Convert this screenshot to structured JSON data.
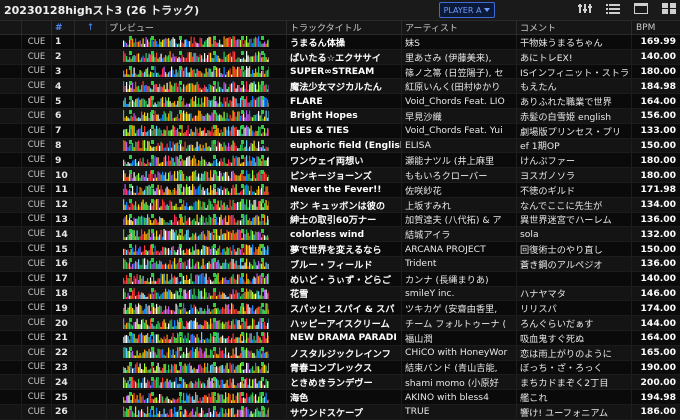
{
  "header": {
    "title": "20230128highスト3 (26 トラック)",
    "player_label": "PLAYER A"
  },
  "icons": [
    "settings-icon",
    "list-view-icon",
    "layout-icon",
    "grid-view-icon"
  ],
  "columns": {
    "num": "#",
    "sort": "↑",
    "preview": "プレビュー",
    "title": "トラックタイトル",
    "artist": "アーティスト",
    "comment": "コメント",
    "bpm": "BPM"
  },
  "accent": "#4f8cff",
  "tracks": [
    {
      "cue": "CUE",
      "num": "1",
      "title": "うまるん体操",
      "artist": "妹S",
      "comment": "干物妹うまるちゃん",
      "bpm": "169.99"
    },
    {
      "cue": "CUE",
      "num": "2",
      "title": "ぱいたる☆エクササイ",
      "artist": "里あさみ (伊藤美来),",
      "comment": "あにトレEX!",
      "bpm": "140.00"
    },
    {
      "cue": "CUE",
      "num": "3",
      "title": "SUPER∞STREAM",
      "artist": "篠ノ之箒 (日笠陽子), セ",
      "comment": "ISインフィニット・ストラ",
      "bpm": "180.00"
    },
    {
      "cue": "CUE",
      "num": "4",
      "title": "魔法少女マジカルたん",
      "artist": "紅原いんく(田村ゆかり",
      "comment": "もえたん",
      "bpm": "184.98"
    },
    {
      "cue": "CUE",
      "num": "5",
      "title": "FLARE",
      "artist": "Void_Chords Feat. LIO",
      "comment": "ありふれた職業で世界",
      "bpm": "164.00"
    },
    {
      "cue": "CUE",
      "num": "6",
      "title": "Bright Hopes",
      "artist": "早見沙織",
      "comment": "赤髪の白雪姫 english",
      "bpm": "156.00"
    },
    {
      "cue": "CUE",
      "num": "7",
      "title": "LIES & TIES",
      "artist": "Void_Chords Feat. Yui",
      "comment": "劇場版プリンセス・プリ",
      "bpm": "133.00"
    },
    {
      "cue": "CUE",
      "num": "8",
      "title": "euphoric field (English",
      "artist": "ELISA",
      "comment": "ef 1期OP",
      "bpm": "150.00"
    },
    {
      "cue": "CUE",
      "num": "9",
      "title": "ワンウェイ両想い",
      "artist": "瀬能ナツル (井上麻里",
      "comment": "けんぷファー",
      "bpm": "180.00"
    },
    {
      "cue": "CUE",
      "num": "10",
      "title": "ピンキージョーンズ",
      "artist": "ももいろクローバー",
      "comment": "ヨスガノソラ",
      "bpm": "180.00"
    },
    {
      "cue": "CUE",
      "num": "11",
      "title": "Never the Fever!!",
      "artist": "佐咲紗花",
      "comment": "不徳のギルド",
      "bpm": "171.98"
    },
    {
      "cue": "CUE",
      "num": "12",
      "title": "ボン キュッボンは彼の",
      "artist": "上坂すみれ",
      "comment": "なんでここに先生が",
      "bpm": "134.00"
    },
    {
      "cue": "CUE",
      "num": "13",
      "title": "紳士の取引60万ナー",
      "artist": "加賀達夫 (八代拓) & ア",
      "comment": "異世界迷宮でハーレム",
      "bpm": "136.00"
    },
    {
      "cue": "CUE",
      "num": "14",
      "title": "colorless wind",
      "artist": "結城アイラ",
      "comment": "sola",
      "bpm": "132.00"
    },
    {
      "cue": "CUE",
      "num": "15",
      "title": "夢で世界を変えるなら",
      "artist": "ARCANA PROJECT",
      "comment": "回復術士のやり直し",
      "bpm": "150.00"
    },
    {
      "cue": "CUE",
      "num": "16",
      "title": "ブルー・フィールド",
      "artist": "Trident",
      "comment": "蒼き鋼のアルペジオ",
      "bpm": "136.00"
    },
    {
      "cue": "CUE",
      "num": "17",
      "title": "めいど・うぃず・どらご",
      "artist": "カンナ (長縄まりあ)",
      "comment": "",
      "bpm": "140.00"
    },
    {
      "cue": "CUE",
      "num": "18",
      "title": "花雪",
      "artist": "smileY inc.",
      "comment": "ハナヤマタ",
      "bpm": "146.00"
    },
    {
      "cue": "CUE",
      "num": "19",
      "title": "スパッと! スパイ & スパ",
      "artist": "ツキカゲ (安齋由香里,",
      "comment": "リリスパ",
      "bpm": "174.00"
    },
    {
      "cue": "CUE",
      "num": "20",
      "title": "ハッピーアイスクリーム",
      "artist": "チーム フォルトゥーナ (",
      "comment": "ろんぐらいだぁす",
      "bpm": "144.00"
    },
    {
      "cue": "CUE",
      "num": "21",
      "title": "NEW DRAMA PARADI",
      "artist": "福山潤",
      "comment": "吸血鬼すぐ死ぬ",
      "bpm": "164.00"
    },
    {
      "cue": "CUE",
      "num": "22",
      "title": "ノスタルジックレインフ",
      "artist": "CHiCO with HoneyWor",
      "comment": "恋は雨上がりのように",
      "bpm": "165.00"
    },
    {
      "cue": "CUE",
      "num": "23",
      "title": "青春コンプレックス",
      "artist": "結束バンド (青山吉能,",
      "comment": "ぼっち・ざ・ろっく",
      "bpm": "190.00"
    },
    {
      "cue": "CUE",
      "num": "24",
      "title": "ときめきランデヴー",
      "artist": "shami momo (小原好",
      "comment": "まちカドまぞく2丁目",
      "bpm": "200.00"
    },
    {
      "cue": "CUE",
      "num": "25",
      "title": "海色",
      "artist": "AKINO with bless4",
      "comment": "艦これ",
      "bpm": "194.98"
    },
    {
      "cue": "CUE",
      "num": "26",
      "title": "サウンドスケープ",
      "artist": "TRUE",
      "comment": "響け! ユーフォニアム",
      "bpm": "186.00"
    }
  ]
}
